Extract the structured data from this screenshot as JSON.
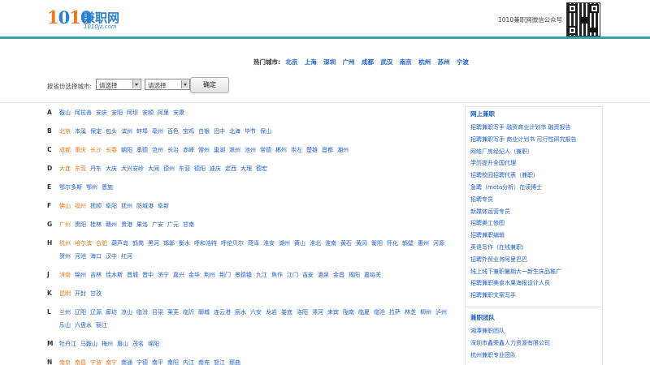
{
  "header": {
    "logo_number": "1010",
    "logo_cn": "兼职网",
    "logo_domain": "1010jz.com",
    "wechat_label": "1010兼职网微信公众号",
    "qr_icon": "qr-code-icon"
  },
  "hot_cities": {
    "label": "热门城市:",
    "items": [
      "北京",
      "上海",
      "深圳",
      "广州",
      "成都",
      "武汉",
      "南京",
      "杭州",
      "苏州",
      "宁波"
    ]
  },
  "selector": {
    "label": "按省份选择城市:",
    "province_value": "请选择",
    "city_value": "请选择",
    "confirm_label": "确定"
  },
  "city_rows": [
    {
      "letter": "A",
      "cities": [
        {
          "n": "鞍山"
        },
        {
          "n": "阿拉善"
        },
        {
          "n": "安庆"
        },
        {
          "n": "安阳"
        },
        {
          "n": "阿坝"
        },
        {
          "n": "安顺"
        },
        {
          "n": "阿里"
        },
        {
          "n": "安康"
        }
      ]
    },
    {
      "letter": "B",
      "cities": [
        {
          "n": "北京",
          "hl": true
        },
        {
          "n": "本溪"
        },
        {
          "n": "保定"
        },
        {
          "n": "包头"
        },
        {
          "n": "滨州"
        },
        {
          "n": "蚌埠"
        },
        {
          "n": "亳州"
        },
        {
          "n": "百色"
        },
        {
          "n": "宝鸡"
        },
        {
          "n": "白银"
        },
        {
          "n": "巴中"
        },
        {
          "n": "北海"
        },
        {
          "n": "毕节"
        },
        {
          "n": "保山"
        }
      ]
    },
    {
      "letter": "C",
      "cities": [
        {
          "n": "成都",
          "hl": true
        },
        {
          "n": "重庆",
          "hl": true
        },
        {
          "n": "长沙",
          "hl": true
        },
        {
          "n": "长春",
          "hl": true
        },
        {
          "n": "朝阳"
        },
        {
          "n": "承德"
        },
        {
          "n": "沧州"
        },
        {
          "n": "长治"
        },
        {
          "n": "赤峰"
        },
        {
          "n": "常州"
        },
        {
          "n": "巢湖"
        },
        {
          "n": "滁州"
        },
        {
          "n": "池州"
        },
        {
          "n": "常德"
        },
        {
          "n": "郴州"
        },
        {
          "n": "崇左"
        },
        {
          "n": "楚雄"
        },
        {
          "n": "昌都"
        },
        {
          "n": "潮州"
        }
      ]
    },
    {
      "letter": "D",
      "cities": [
        {
          "n": "大连",
          "hl": true
        },
        {
          "n": "东莞",
          "hl": true
        },
        {
          "n": "丹东"
        },
        {
          "n": "大庆"
        },
        {
          "n": "大兴安岭"
        },
        {
          "n": "大同"
        },
        {
          "n": "德州"
        },
        {
          "n": "东营"
        },
        {
          "n": "德阳"
        },
        {
          "n": "迪庆"
        },
        {
          "n": "定西"
        },
        {
          "n": "大理"
        },
        {
          "n": "德宏"
        }
      ]
    },
    {
      "letter": "E",
      "cities": [
        {
          "n": "鄂尔多斯"
        },
        {
          "n": "鄂州"
        },
        {
          "n": "恩施"
        }
      ]
    },
    {
      "letter": "F",
      "cities": [
        {
          "n": "佛山",
          "hl": true
        },
        {
          "n": "福州",
          "hl": true
        },
        {
          "n": "抚顺"
        },
        {
          "n": "阜阳"
        },
        {
          "n": "抚州"
        },
        {
          "n": "防城港"
        },
        {
          "n": "阜新"
        }
      ]
    },
    {
      "letter": "G",
      "cities": [
        {
          "n": "广州",
          "hl": true
        },
        {
          "n": "贵阳"
        },
        {
          "n": "桂林"
        },
        {
          "n": "赣州"
        },
        {
          "n": "贵港"
        },
        {
          "n": "果洛"
        },
        {
          "n": "广安"
        },
        {
          "n": "广元"
        },
        {
          "n": "甘南"
        }
      ]
    },
    {
      "letter": "H",
      "cities": [
        {
          "n": "杭州",
          "hl": true
        },
        {
          "n": "哈尔滨",
          "hl": true
        },
        {
          "n": "合肥",
          "hl": true
        },
        {
          "n": "葫芦岛"
        },
        {
          "n": "鹤岗"
        },
        {
          "n": "黑河"
        },
        {
          "n": "邯郸"
        },
        {
          "n": "衡水"
        },
        {
          "n": "呼和浩特"
        },
        {
          "n": "呼伦贝尔"
        },
        {
          "n": "菏泽"
        },
        {
          "n": "淮安"
        },
        {
          "n": "湖州"
        },
        {
          "n": "黄山"
        },
        {
          "n": "淮北"
        },
        {
          "n": "淮南"
        },
        {
          "n": "黄石"
        },
        {
          "n": "黄冈"
        },
        {
          "n": "衡阳"
        },
        {
          "n": "怀化"
        },
        {
          "n": "鹤壁"
        },
        {
          "n": "惠州"
        },
        {
          "n": "河源"
        },
        {
          "n": "贺州"
        },
        {
          "n": "河池"
        },
        {
          "n": "海口"
        },
        {
          "n": "汉中"
        },
        {
          "n": "红河"
        }
      ]
    },
    {
      "letter": "J",
      "cities": [
        {
          "n": "济南",
          "hl": true
        },
        {
          "n": "锦州"
        },
        {
          "n": "吉林"
        },
        {
          "n": "佳木斯"
        },
        {
          "n": "晋城"
        },
        {
          "n": "晋中"
        },
        {
          "n": "济宁"
        },
        {
          "n": "嘉兴"
        },
        {
          "n": "金华"
        },
        {
          "n": "荆州"
        },
        {
          "n": "荆门"
        },
        {
          "n": "景德镇"
        },
        {
          "n": "九江"
        },
        {
          "n": "焦作"
        },
        {
          "n": "江门"
        },
        {
          "n": "吉安"
        },
        {
          "n": "酒泉"
        },
        {
          "n": "金昌"
        },
        {
          "n": "揭阳"
        },
        {
          "n": "嘉峪关"
        }
      ]
    },
    {
      "letter": "K",
      "cities": [
        {
          "n": "昆明",
          "hl": true
        },
        {
          "n": "开封"
        },
        {
          "n": "甘孜"
        }
      ]
    },
    {
      "letter": "L",
      "cities": [
        {
          "n": "兰州"
        },
        {
          "n": "辽阳"
        },
        {
          "n": "辽源"
        },
        {
          "n": "廊坊"
        },
        {
          "n": "凉山"
        },
        {
          "n": "临汾"
        },
        {
          "n": "吕梁"
        },
        {
          "n": "莱芜"
        },
        {
          "n": "临沂"
        },
        {
          "n": "聊城"
        },
        {
          "n": "连云港"
        },
        {
          "n": "丽水"
        },
        {
          "n": "六安"
        },
        {
          "n": "龙岩"
        },
        {
          "n": "娄底"
        },
        {
          "n": "洛阳"
        },
        {
          "n": "漯河"
        },
        {
          "n": "来宾"
        },
        {
          "n": "陇南"
        },
        {
          "n": "临夏"
        },
        {
          "n": "临沧"
        },
        {
          "n": "拉萨"
        },
        {
          "n": "林芝"
        },
        {
          "n": "柳州"
        },
        {
          "n": "泸州"
        },
        {
          "n": "乐山"
        },
        {
          "n": "六盘水"
        },
        {
          "n": "丽江"
        }
      ]
    },
    {
      "letter": "M",
      "cities": [
        {
          "n": "牡丹江"
        },
        {
          "n": "马鞍山"
        },
        {
          "n": "梅州"
        },
        {
          "n": "眉山"
        },
        {
          "n": "茂名"
        },
        {
          "n": "绵阳"
        }
      ]
    },
    {
      "letter": "N",
      "cities": [
        {
          "n": "南京",
          "hl": true
        },
        {
          "n": "南昌",
          "hl": true
        },
        {
          "n": "宁波",
          "hl": true
        },
        {
          "n": "南宁",
          "hl": true
        },
        {
          "n": "南通"
        },
        {
          "n": "宁德"
        },
        {
          "n": "南平"
        },
        {
          "n": "南阳"
        },
        {
          "n": "内江"
        },
        {
          "n": "南充"
        },
        {
          "n": "怒江"
        },
        {
          "n": "那曲"
        }
      ]
    }
  ],
  "sidebar": {
    "section1_title": "网上兼职",
    "section1_items": [
      "招聘兼职写手 融资商业计划书 融资报告",
      "招聘兼职写手 商业计划书 可行性研究报告",
      "网络厂房经纪人（兼职）",
      "学历提升全国代理",
      "招聘校园招聘代表（兼职）",
      "急聘（meta分析）在读博士",
      "招聘专员",
      "新媒体运营专员",
      "招聘美工修图",
      "招聘兼职编辑",
      "英语写作（在线兼职）",
      "招聘外贸业务阿里巴巴",
      "线上线下兼职暑期大一新生床品推广",
      "招聘兼职美食水果海报设计人员",
      "招聘兼职文案写手"
    ],
    "section2_title": "兼职团队",
    "section2_items": [
      "湘潭兼职团队",
      "深圳市鑫荣鑫人力资源有限公司",
      "杭州兼职专业团队"
    ]
  }
}
